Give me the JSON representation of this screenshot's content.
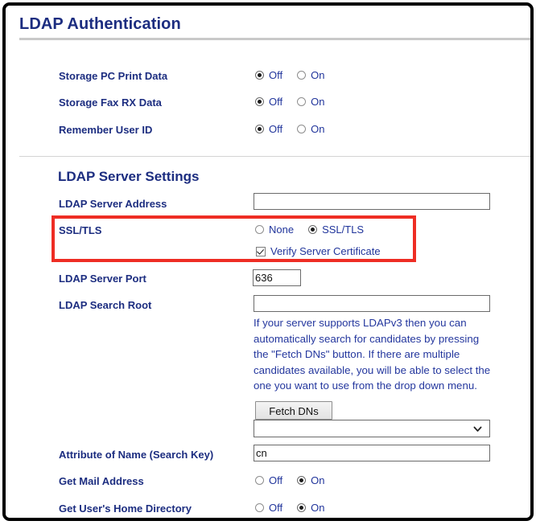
{
  "window": {
    "title": "LDAP Authentication"
  },
  "auth_settings": {
    "rows": [
      {
        "label": "Storage PC Print Data",
        "off_label": "Off",
        "on_label": "On",
        "value": "Off"
      },
      {
        "label": "Storage Fax RX Data",
        "off_label": "Off",
        "on_label": "On",
        "value": "Off"
      },
      {
        "label": "Remember User ID",
        "off_label": "Off",
        "on_label": "On",
        "value": "Off"
      }
    ]
  },
  "server_settings": {
    "heading": "LDAP Server Settings",
    "address": {
      "label": "LDAP Server Address",
      "value": ""
    },
    "ssl_tls": {
      "label": "SSL/TLS",
      "none_label": "None",
      "ssl_label": "SSL/TLS",
      "selected": "SSL/TLS",
      "verify_label": "Verify Server Certificate",
      "verify_checked": true,
      "highlight_color": "#ee2d24"
    },
    "port": {
      "label": "LDAP Server Port",
      "value": "636"
    },
    "search_root": {
      "label": "LDAP Search Root",
      "value": "",
      "help_text": "If your server supports LDAPv3 then you can automatically search for candidates by pressing the \"Fetch DNs\" button. If there are multiple candidates available, you will be able to select the one you want to use from the drop down menu.",
      "fetch_button_label": "Fetch DNs",
      "dn_dropdown_value": "",
      "dn_dropdown_icon": "chevron-down-icon"
    },
    "attribute_name": {
      "label": "Attribute of Name (Search Key)",
      "value": "cn"
    },
    "get_mail_address": {
      "label": "Get Mail Address",
      "off_label": "Off",
      "on_label": "On",
      "value": "On"
    },
    "get_home_directory": {
      "label": "Get User's Home Directory",
      "off_label": "Off",
      "on_label": "On",
      "value": "On"
    }
  },
  "theme": {
    "label_color": "#1c2d80",
    "text_color": "#20349b",
    "frame_color": "#000000"
  }
}
